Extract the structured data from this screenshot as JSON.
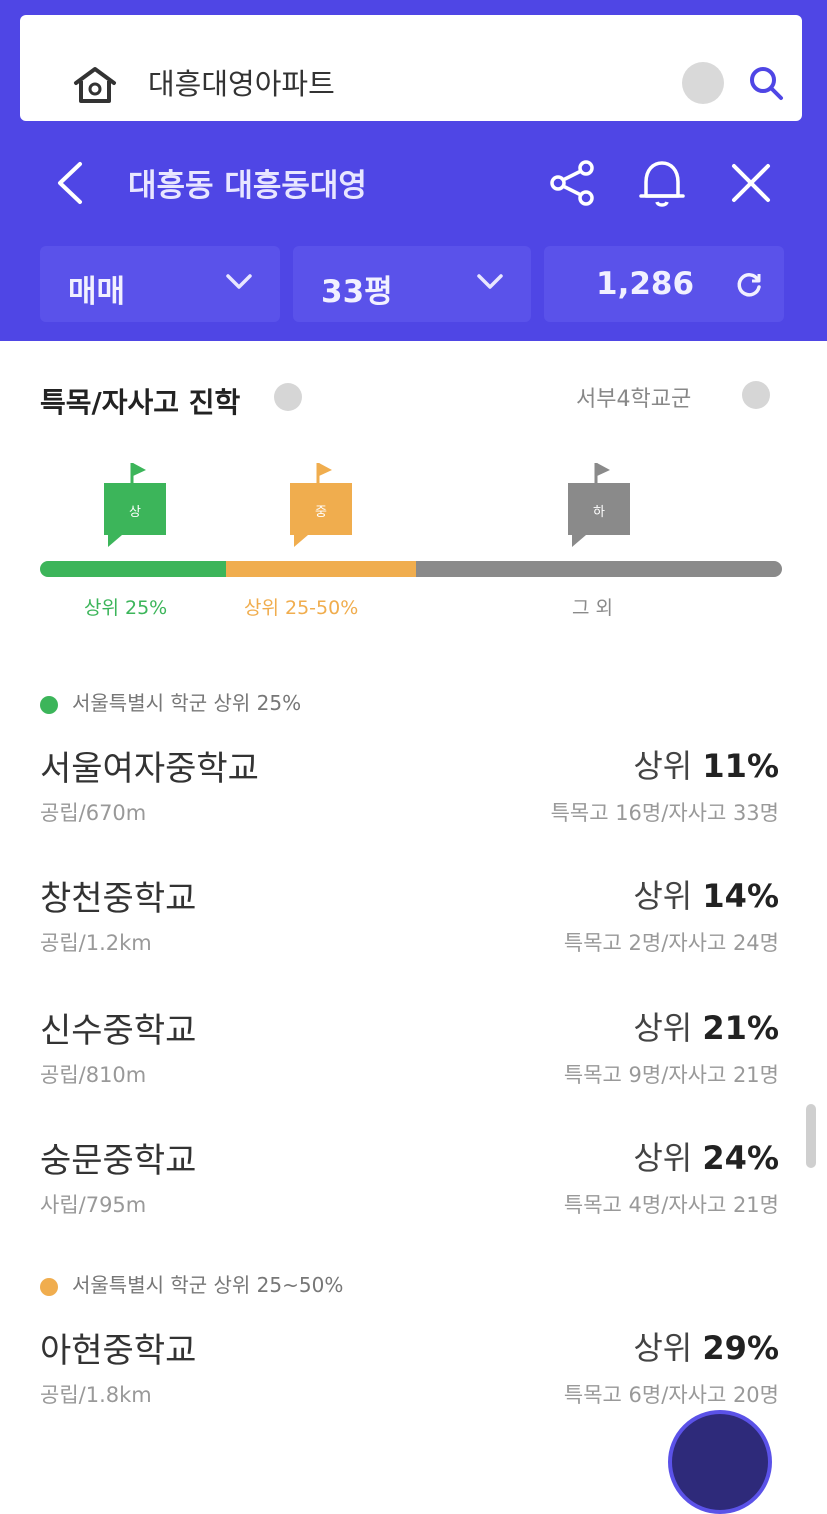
{
  "search": {
    "value": "대흥대영아파트"
  },
  "nav": {
    "title": "대흥동 대흥동대영"
  },
  "filters": [
    {
      "label": "매매"
    },
    {
      "label": "33평"
    },
    {
      "label": "1,286"
    }
  ],
  "section": {
    "title": "특목/자사고 진학",
    "right_label": "서부4학교군"
  },
  "progress": {
    "flags": [
      "상",
      "중",
      "하"
    ],
    "labels": [
      "상위 25%",
      "상위 25-50%",
      "그 외"
    ],
    "colors": {
      "top": "#3cb55a",
      "mid": "#f0ad4e",
      "rest": "#8a8a8a",
      "accent": "#4f46e5"
    }
  },
  "groups": [
    {
      "legend": "서울특별시 학군 상위 25%",
      "schools": [
        {
          "name": "서울여자중학교",
          "meta": "공립/670m",
          "rank_prefix": "상위 ",
          "rank_value": "11%",
          "stat": "특목고 16명/자사고 33명"
        },
        {
          "name": "창천중학교",
          "meta": "공립/1.2km",
          "rank_prefix": "상위 ",
          "rank_value": "14%",
          "stat": "특목고 2명/자사고 24명"
        },
        {
          "name": "신수중학교",
          "meta": "공립/810m",
          "rank_prefix": "상위 ",
          "rank_value": "21%",
          "stat": "특목고 9명/자사고 21명"
        },
        {
          "name": "숭문중학교",
          "meta": "사립/795m",
          "rank_prefix": "상위 ",
          "rank_value": "24%",
          "stat": "특목고 4명/자사고 21명"
        }
      ]
    },
    {
      "legend": "서울특별시 학군 상위 25~50%",
      "schools": [
        {
          "name": "아현중학교",
          "meta": "공립/1.8km",
          "rank_prefix": "상위 ",
          "rank_value": "29%",
          "stat": "특목고 6명/자사고 20명"
        }
      ]
    }
  ]
}
